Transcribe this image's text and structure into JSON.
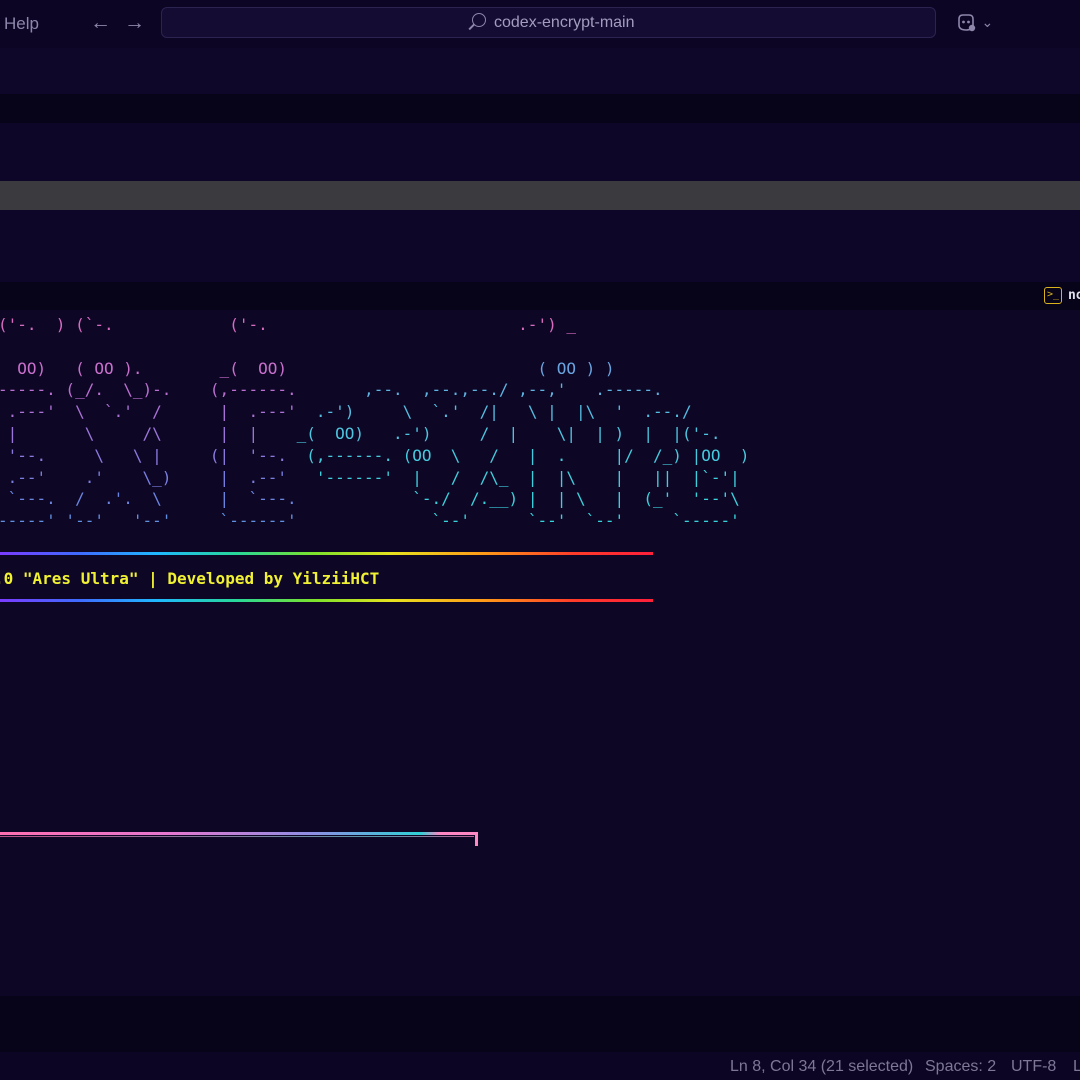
{
  "titlebar": {
    "menu_help": "Help",
    "back_arrow": "←",
    "forward_arrow": "→",
    "search_text": "codex-encrypt-main",
    "copilot_chevron": "⌄"
  },
  "terminal": {
    "tab_icon": ">_",
    "tab_label_partial": "no",
    "ascii_lines": [
      {
        "parts": [
          {
            "t": "('-.  ) (`-.            ('-.                          .-') _",
            "c": "#d66bc0"
          }
        ]
      },
      {
        "parts": [
          {
            "t": " ",
            "c": "#d66bc0"
          }
        ]
      },
      {
        "parts": [
          {
            "t": "  OO)   ( OO ).        _(  OO)",
            "c": "#c96fcc"
          },
          {
            "t": "                          ( OO ) )",
            "c": "#6aa4e0"
          }
        ]
      },
      {
        "parts": [
          {
            "t": "-----. (_/.  \\_)-.    (,------.",
            "c": "#bb6fd0"
          },
          {
            "t": "       ,--.  ,--.,--./ ,--,'   .-----.",
            "c": "#5eb3e0"
          }
        ]
      },
      {
        "parts": [
          {
            "t": " .---'  \\  `.'  /      |  .---'",
            "c": "#ab72d6"
          },
          {
            "t": "  .-')     \\  `.'  /|   \\ |  |\\  '  .--./",
            "c": "#55bde0"
          }
        ]
      },
      {
        "parts": [
          {
            "t": " |       \\     /\\      |  |",
            "c": "#9b76da"
          },
          {
            "t": "    _(  OO)   .-')     /  |    \\|  | )  |  |('-.",
            "c": "#4ec5df"
          }
        ]
      },
      {
        "parts": [
          {
            "t": " '--.     \\   \\ |     (|  '--.",
            "c": "#8a7ade"
          },
          {
            "t": "  (,------. (OO  \\   /   |  .     |/  /_) |OO  )",
            "c": "#45cbdd"
          }
        ]
      },
      {
        "parts": [
          {
            "t": " .--'    .'    \\_)     |  .--'",
            "c": "#7a7fe0"
          },
          {
            "t": "   '------'  |   /  /\\_  |  |\\    |   ||  |`-'|",
            "c": "#3fcfdc"
          }
        ]
      },
      {
        "parts": [
          {
            "t": " `---.  /  .'.  \\      |  `---.",
            "c": "#6c85e0"
          },
          {
            "t": "            `-./  /.__) |  | \\   |  (_'  '--'\\",
            "c": "#3ad1db"
          }
        ]
      },
      {
        "parts": [
          {
            "t": "-----' '--'   '--'     `------'",
            "c": "#6290e0"
          },
          {
            "t": "              `--'      `--'  `--'     `-----'",
            "c": "#36d3da"
          }
        ]
      }
    ],
    "info_line": ".0 \"Ares Ultra\" | Developed by YilziiHCT"
  },
  "colors": {
    "background": "#0d0625",
    "info_text": "#f1f133",
    "terminal_icon": "#d9b21c"
  },
  "statusbar": {
    "position": "Ln 8, Col 34 (21 selected)",
    "spaces": "Spaces: 2",
    "encoding": "UTF-8",
    "eol_partial": "L"
  }
}
